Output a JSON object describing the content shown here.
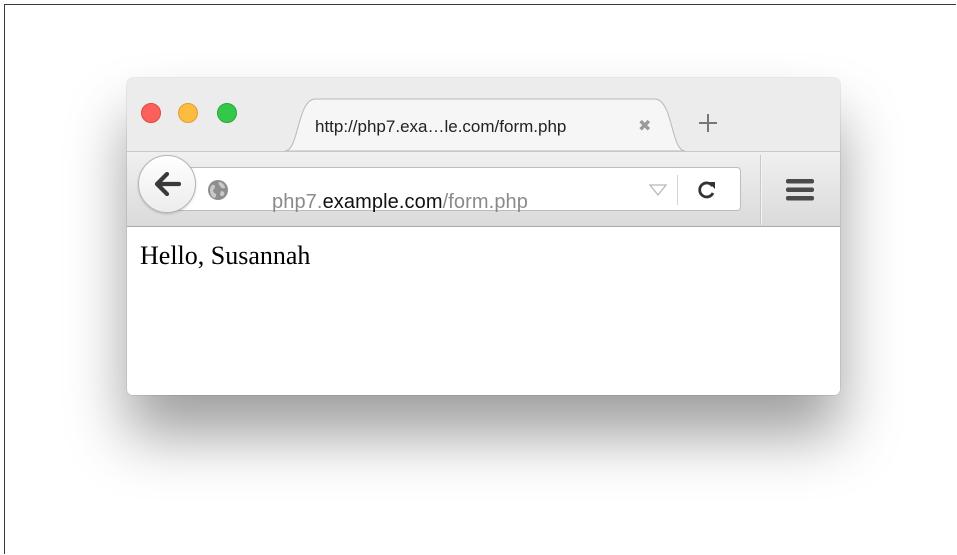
{
  "tab": {
    "title": "http://php7.exa…le.com/form.php",
    "close_glyph": "✖",
    "new_tab_icon": "plus-icon"
  },
  "urlbar": {
    "prefix": "php7.",
    "host": "example.com",
    "path": "/form.php",
    "site_icon": "globe-icon"
  },
  "page": {
    "greeting": "Hello, Susannah"
  },
  "colors": {
    "close": "#fc605b",
    "minimize": "#fdbc40",
    "zoom": "#34c84a"
  }
}
